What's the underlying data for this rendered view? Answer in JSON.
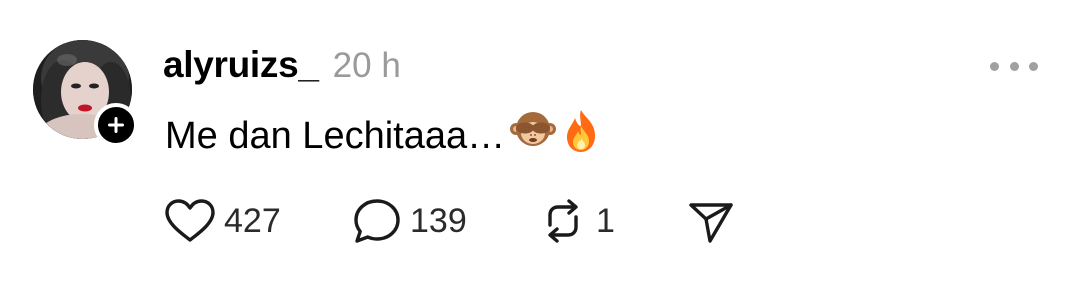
{
  "post": {
    "username": "alyruizs_",
    "timestamp": "20 h",
    "text": "Me dan Lechitaaa…",
    "emojis": [
      "see-no-evil-monkey",
      "fire"
    ]
  },
  "actions": {
    "likes": "427",
    "comments": "139",
    "reposts": "1"
  },
  "icons": {
    "like": "heart-icon",
    "comment": "comment-bubble-icon",
    "repost": "repost-icon",
    "share": "send-icon",
    "more": "more-icon",
    "follow": "plus-icon"
  },
  "colors": {
    "text": "#000000",
    "muted": "#9a9a9a",
    "badge": "#000000"
  }
}
